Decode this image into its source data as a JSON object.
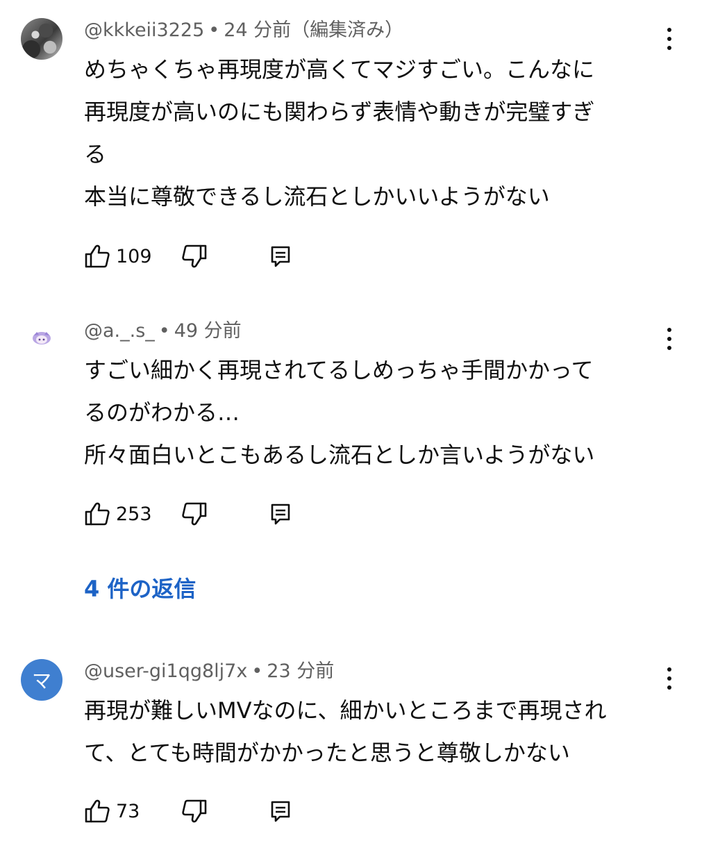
{
  "comments": [
    {
      "author": "@kkkeii3225",
      "time": "24 分前（編集済み）",
      "lines": [
        "めちゃくちゃ再現度が高くてマジすごい。こんなに",
        "再現度が高いのにも関わらず表情や動きが完璧すぎ",
        "る",
        "本当に尊敬できるし流石としかいいようがない"
      ],
      "likes": "109",
      "avatar_icon": "photo-avatar"
    },
    {
      "author": "@a._.s_",
      "time": "49 分前",
      "lines": [
        "すごい細かく再現されてるしめっちゃ手間かかって",
        "るのがわかる…",
        "所々面白いとこもあるし流石としか言いようがない"
      ],
      "likes": "253",
      "avatar_icon": "character-avatar"
    },
    {
      "author": "@user-gi1qg8lj7x",
      "time": "23 分前",
      "lines": [
        "再現が難しいMVなのに、細かいところまで再現され",
        "て、とても時間がかかったと思うと尊敬しかない"
      ],
      "likes": "73",
      "avatar_letter": "マ",
      "avatar_color": "#3f7fd0"
    }
  ],
  "replies_label": "4 件の返信",
  "colors": {
    "text": "#0f0f0f",
    "meta": "#606060",
    "link": "#1d63c6"
  },
  "icons": [
    "like-icon",
    "dislike-icon",
    "reply-icon",
    "more-vert-icon"
  ]
}
